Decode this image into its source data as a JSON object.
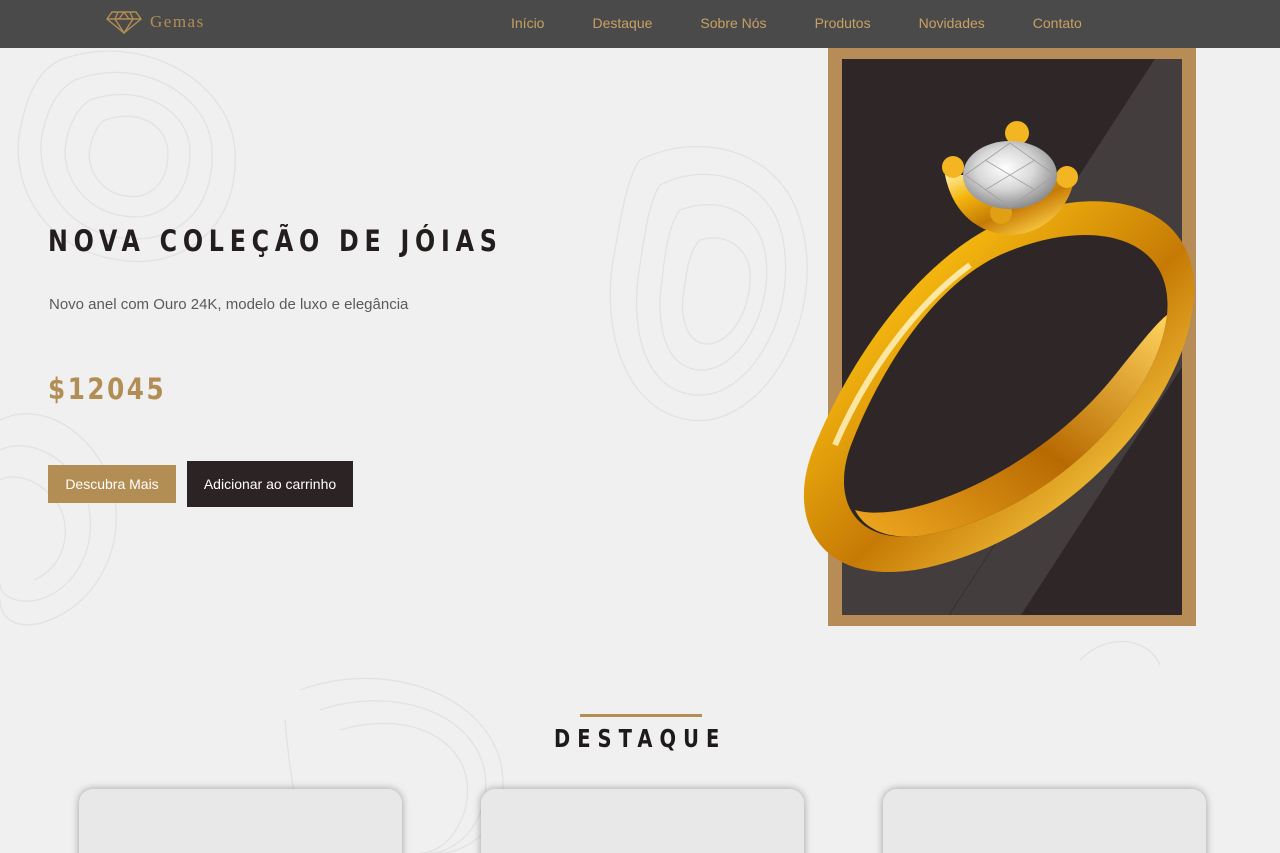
{
  "brand": {
    "name": "Gemas",
    "icon": "diamond-icon"
  },
  "nav": {
    "items": [
      {
        "label": "Início",
        "id": "inicio"
      },
      {
        "label": "Destaque",
        "id": "destaque"
      },
      {
        "label": "Sobre Nós",
        "id": "sobre"
      },
      {
        "label": "Produtos",
        "id": "produtos"
      },
      {
        "label": "Novidades",
        "id": "novidades"
      },
      {
        "label": "Contato",
        "id": "contato"
      }
    ]
  },
  "hero": {
    "title": "NOVA COLEÇÃO DE JÓIAS",
    "subtitle": "Novo anel com Ouro 24K, modelo de luxo e elegância",
    "price": "$12045",
    "primary_button": "Descubra Mais",
    "secondary_button": "Adicionar ao carrinho",
    "image": "gold-diamond-ring"
  },
  "featured": {
    "title": "DESTAQUE",
    "cards": [
      {},
      {},
      {}
    ]
  },
  "colors": {
    "accent": "#b28d54",
    "header_bg": "#4a4a4a",
    "dark": "#2c2424",
    "page_bg": "#f0f0f0"
  }
}
